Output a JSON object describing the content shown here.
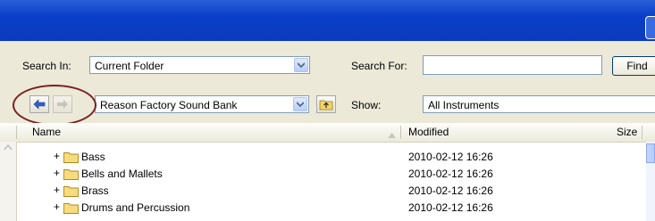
{
  "toolbar": {
    "search_in_label": "Search In:",
    "search_in_value": "Current Folder",
    "search_for_label": "Search For:",
    "search_for_value": "",
    "find_label": "Find",
    "location_value": "Reason Factory Sound Bank",
    "show_label": "Show:",
    "show_value": "All Instruments"
  },
  "list": {
    "headers": {
      "name": "Name",
      "modified": "Modified",
      "size": "Size"
    },
    "rows": [
      {
        "expander": "+",
        "name": "Bass",
        "modified": "2010-02-12 16:26"
      },
      {
        "expander": "+",
        "name": "Bells and Mallets",
        "modified": "2010-02-12 16:26"
      },
      {
        "expander": "+",
        "name": "Brass",
        "modified": "2010-02-12 16:26"
      },
      {
        "expander": "+",
        "name": "Drums and Percussion",
        "modified": "2010-02-12 16:26"
      }
    ]
  },
  "icons": [
    "back-arrow-icon",
    "forward-arrow-icon",
    "up-folder-icon",
    "folder-icon",
    "chevron-down-icon",
    "sort-triangle-icon"
  ],
  "colors": {
    "titlebar": "#0b3bbe",
    "panel": "#ece9d8",
    "highlight_circle": "#7a1f1f"
  }
}
